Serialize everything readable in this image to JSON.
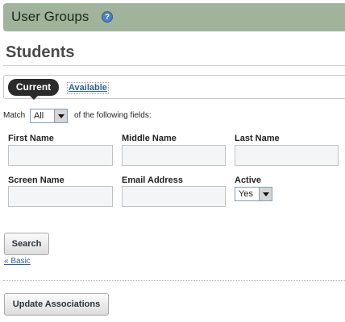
{
  "header": {
    "title": "User Groups",
    "help_glyph": "?"
  },
  "page": {
    "title": "Students"
  },
  "tabs": {
    "current": "Current",
    "available": "Available"
  },
  "match": {
    "prefix": "Match",
    "selected": "All",
    "suffix": "of the following fields:"
  },
  "fields": {
    "first_name": {
      "label": "First Name",
      "value": ""
    },
    "middle_name": {
      "label": "Middle Name",
      "value": ""
    },
    "last_name": {
      "label": "Last Name",
      "value": ""
    },
    "screen_name": {
      "label": "Screen Name",
      "value": ""
    },
    "email_address": {
      "label": "Email Address",
      "value": ""
    },
    "active": {
      "label": "Active",
      "selected": "Yes"
    }
  },
  "actions": {
    "search_label": "Search",
    "basic_link": "« Basic",
    "update_label": "Update Associations"
  },
  "colors": {
    "header_bg": "#9fb49a",
    "link": "#2a5fa8",
    "tab_active_bg": "#2b2b2b"
  },
  "icons": {
    "help": "help-icon"
  }
}
